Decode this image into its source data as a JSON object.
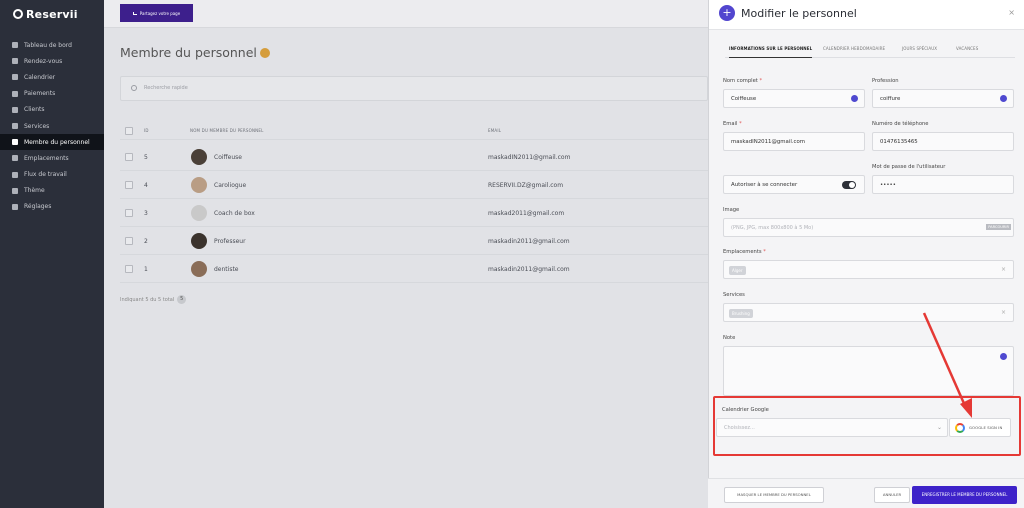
{
  "app": {
    "brand": "Reservii"
  },
  "sidebar": {
    "items": [
      {
        "label": "Tableau de bord",
        "icon": "dashboard-icon"
      },
      {
        "label": "Rendez-vous",
        "icon": "calendar-check-icon"
      },
      {
        "label": "Calendrier",
        "icon": "calendar-icon"
      },
      {
        "label": "Paiements",
        "icon": "payments-icon"
      },
      {
        "label": "Clients",
        "icon": "clients-icon"
      },
      {
        "label": "Services",
        "icon": "services-icon"
      },
      {
        "label": "Membre du personnel",
        "icon": "staff-icon",
        "active": true
      },
      {
        "label": "Emplacements",
        "icon": "location-icon"
      },
      {
        "label": "Flux de travail",
        "icon": "workflow-icon"
      },
      {
        "label": "Thème",
        "icon": "brush-icon"
      },
      {
        "label": "Réglages",
        "icon": "gear-icon"
      }
    ]
  },
  "topbar": {
    "share_label": "Partagez votre page"
  },
  "main": {
    "title": "Membre du personnel",
    "search_placeholder": "Recherche rapide",
    "columns": {
      "id": "ID",
      "name": "NOM DU MEMBRE DU PERSONNEL",
      "email": "EMAIL"
    },
    "rows": [
      {
        "id": "5",
        "name": "Coiffeuse",
        "email": "maskadIN2011@gmail.com"
      },
      {
        "id": "4",
        "name": "Caroliogue",
        "email": "RESERVII.DZ@gmail.com"
      },
      {
        "id": "3",
        "name": "Coach de box",
        "email": "maskad2011@gmail.com"
      },
      {
        "id": "2",
        "name": "Professeur",
        "email": "maskadin2011@gmail.com"
      },
      {
        "id": "1",
        "name": "dentiste",
        "email": "maskadin2011@gmail.com"
      }
    ],
    "footer_text": "Indiquant 5 du 5 total",
    "footer_badge": "5"
  },
  "panel": {
    "title": "Modifier le personnel",
    "close": "×",
    "tabs": [
      "INFORMATIONS SUR LE PERSONNEL",
      "CALENDRIER HEBDOMADAIRE",
      "JOURS SPÉCIAUX",
      "VACANCES"
    ],
    "labels": {
      "full_name": "Nom complet",
      "profession": "Profession",
      "email": "Email",
      "phone": "Numéro de téléphone",
      "password": "Mot de passe de l'utilisateur",
      "image": "Image",
      "locations": "Emplacements",
      "services": "Services",
      "note": "Note",
      "google": "Calendrier Google"
    },
    "values": {
      "full_name": "Coiffeuse",
      "profession": "coiffure",
      "email": "maskadIN2011@gmail.com",
      "phone": "0147613546​5",
      "password": "•••••",
      "allow_login": "Autoriser à se connecter",
      "image_placeholder": "(PNG, JPG, max 800x800 à 5 Mo)",
      "browse": "PARCOURIR",
      "location_tag": "Alger",
      "service_tag": "Brushing",
      "clear": "×",
      "google_placeholder": "Choisissez...",
      "google_chevron": "⌄",
      "google_signin": "GOOGLE SIGN IN"
    },
    "buttons": {
      "hide": "MASQUER LE MEMBRE DU PERSONNEL",
      "cancel": "ANNULER",
      "save": "ENREGISTRER LE MEMBRE DU PERSONNEL"
    }
  },
  "colors": {
    "accent": "#3d22c9",
    "highlight": "#e53935",
    "sidebar_bg": "#2b2f3a"
  }
}
